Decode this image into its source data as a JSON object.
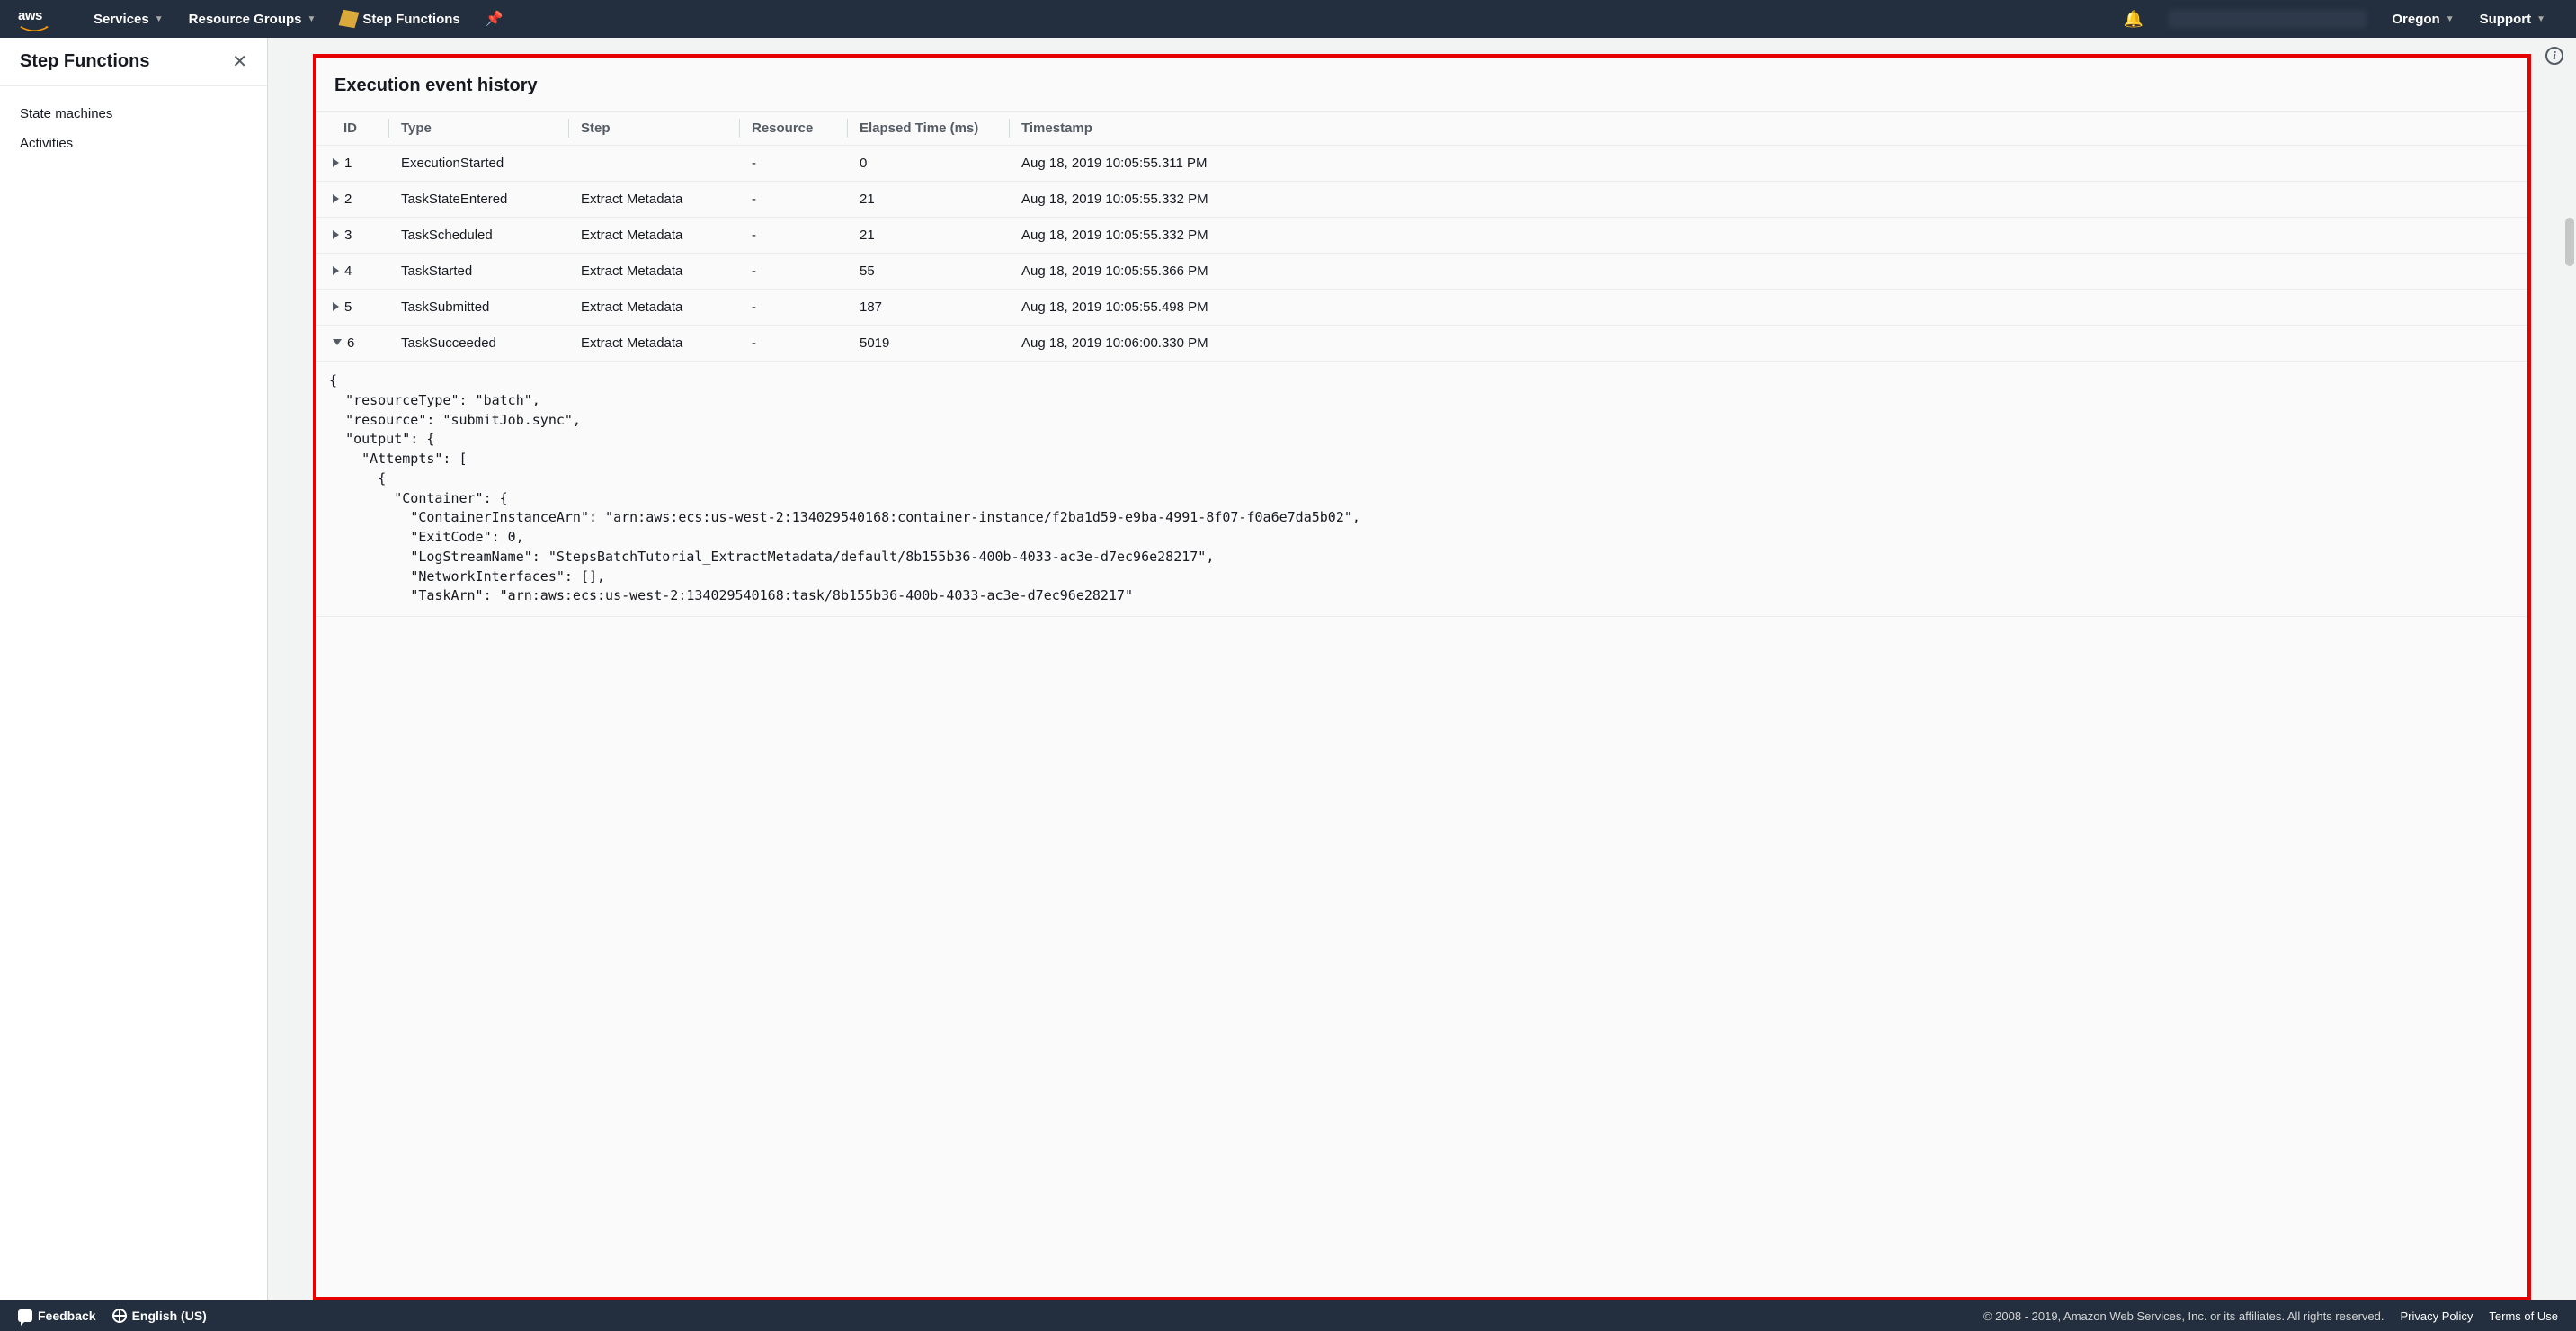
{
  "topnav": {
    "services": "Services",
    "resource_groups": "Resource Groups",
    "step_functions": "Step Functions",
    "region": "Oregon",
    "support": "Support"
  },
  "sidebar": {
    "title": "Step Functions",
    "links": [
      "State machines",
      "Activities"
    ]
  },
  "panel": {
    "title": "Execution event history",
    "columns": [
      "ID",
      "Type",
      "Step",
      "Resource",
      "Elapsed Time (ms)",
      "Timestamp"
    ],
    "rows": [
      {
        "expanded": false,
        "id": "1",
        "type": "ExecutionStarted",
        "step": "",
        "resource": "-",
        "elapsed": "0",
        "timestamp": "Aug 18, 2019 10:05:55.311 PM"
      },
      {
        "expanded": false,
        "id": "2",
        "type": "TaskStateEntered",
        "step": "Extract Metadata",
        "resource": "-",
        "elapsed": "21",
        "timestamp": "Aug 18, 2019 10:05:55.332 PM"
      },
      {
        "expanded": false,
        "id": "3",
        "type": "TaskScheduled",
        "step": "Extract Metadata",
        "resource": "-",
        "elapsed": "21",
        "timestamp": "Aug 18, 2019 10:05:55.332 PM"
      },
      {
        "expanded": false,
        "id": "4",
        "type": "TaskStarted",
        "step": "Extract Metadata",
        "resource": "-",
        "elapsed": "55",
        "timestamp": "Aug 18, 2019 10:05:55.366 PM"
      },
      {
        "expanded": false,
        "id": "5",
        "type": "TaskSubmitted",
        "step": "Extract Metadata",
        "resource": "-",
        "elapsed": "187",
        "timestamp": "Aug 18, 2019 10:05:55.498 PM"
      },
      {
        "expanded": true,
        "id": "6",
        "type": "TaskSucceeded",
        "step": "Extract Metadata",
        "resource": "-",
        "elapsed": "5019",
        "timestamp": "Aug 18, 2019 10:06:00.330 PM"
      }
    ],
    "expanded_json": "{\n  \"resourceType\": \"batch\",\n  \"resource\": \"submitJob.sync\",\n  \"output\": {\n    \"Attempts\": [\n      {\n        \"Container\": {\n          \"ContainerInstanceArn\": \"arn:aws:ecs:us-west-2:134029540168:container-instance/f2ba1d59-e9ba-4991-8f07-f0a6e7da5b02\",\n          \"ExitCode\": 0,\n          \"LogStreamName\": \"StepsBatchTutorial_ExtractMetadata/default/8b155b36-400b-4033-ac3e-d7ec96e28217\",\n          \"NetworkInterfaces\": [],\n          \"TaskArn\": \"arn:aws:ecs:us-west-2:134029540168:task/8b155b36-400b-4033-ac3e-d7ec96e28217\""
  },
  "footer": {
    "feedback": "Feedback",
    "language": "English (US)",
    "copyright": "© 2008 - 2019, Amazon Web Services, Inc. or its affiliates. All rights reserved.",
    "privacy": "Privacy Policy",
    "terms": "Terms of Use"
  }
}
